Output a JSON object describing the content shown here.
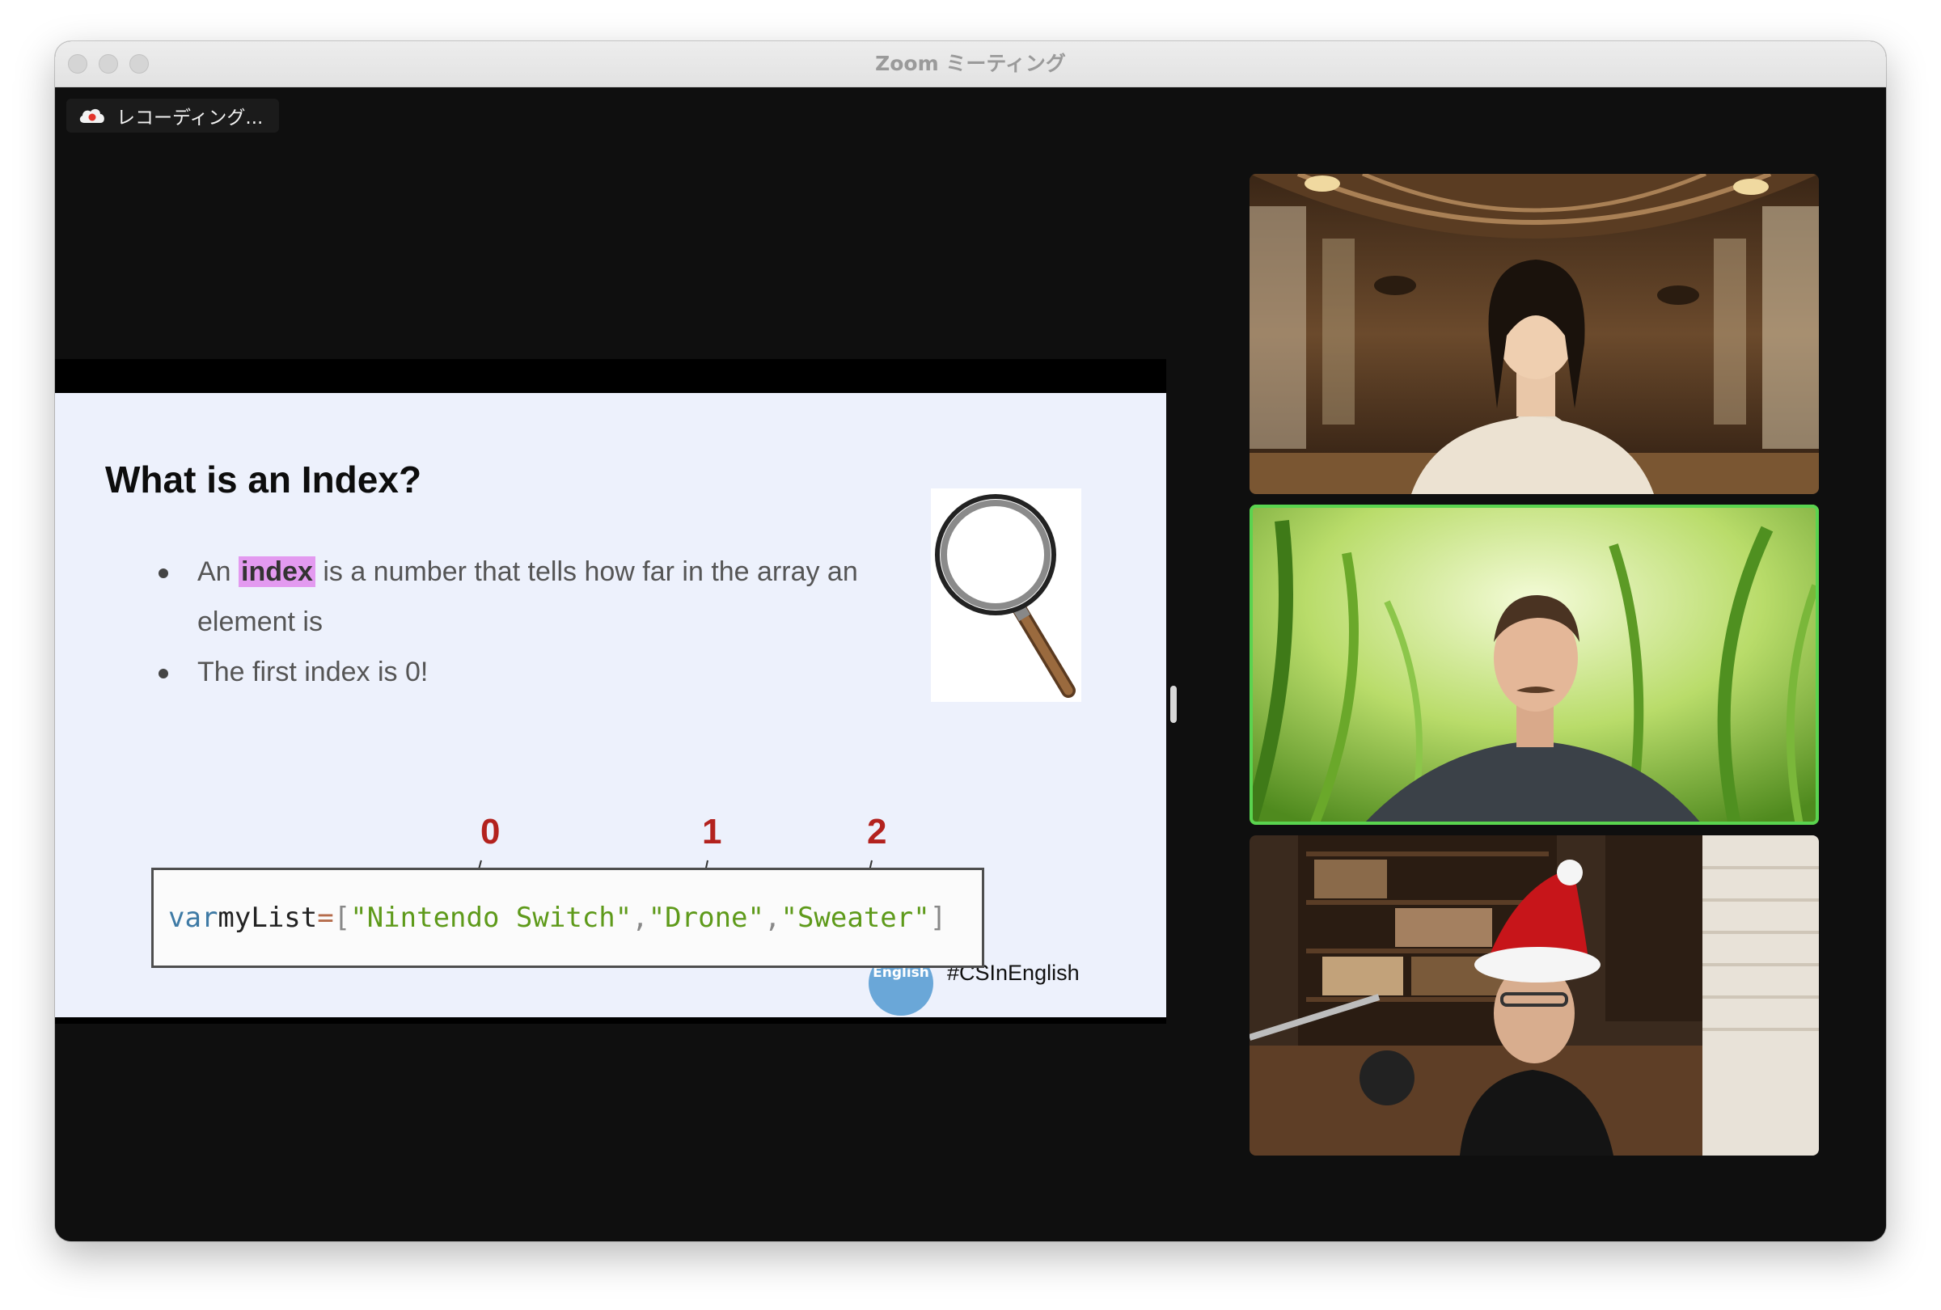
{
  "window": {
    "title": "Zoom ミーティング"
  },
  "recording": {
    "label": "レコーディング..."
  },
  "slide": {
    "title": "What is an Index?",
    "bullet1": {
      "before": "An",
      "highlight": "index",
      "after": "is a number that tells how far in the array an element is"
    },
    "bullet2": "The first index is 0!",
    "indices": [
      "0",
      "1",
      "2"
    ],
    "code": {
      "keyword": "var",
      "name": "myList",
      "equals": "=",
      "open": "[",
      "items": [
        "\"Nintendo Switch\"",
        "\"Drone\"",
        "\"Sweater\""
      ],
      "sep": ",",
      "close": "]"
    },
    "logo_text": "English",
    "hashtag": "#CSInEnglish"
  },
  "colors": {
    "active_speaker_border": "#5ad44f",
    "highlight": "#e39af0",
    "index_red": "#b3221e"
  }
}
